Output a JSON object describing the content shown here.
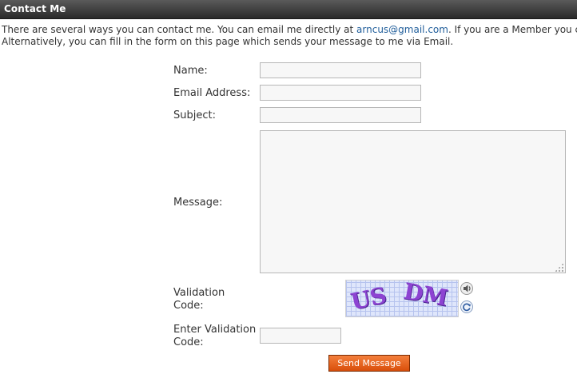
{
  "header": {
    "title": "Contact Me"
  },
  "intro": {
    "line1_before_link": "There are several ways you can contact me. You can email me directly at ",
    "email_link": "arncus@gmail.com",
    "line1_after_link": ". If you are a Member you can se",
    "line2": "Alternatively, you can fill in the form on this page which sends your message to me via Email."
  },
  "form": {
    "name_label": "Name:",
    "name_value": "",
    "email_label": "Email Address:",
    "email_value": "",
    "subject_label": "Subject:",
    "subject_value": "",
    "message_label": "Message:",
    "message_value": "",
    "validation_label_1": "Validation",
    "validation_label_2": "Code:",
    "captcha_text_a": "US",
    "captcha_text_b": "DM",
    "audio_icon": "speaker-icon",
    "refresh_icon": "refresh-icon",
    "enter_validation_label_1": "Enter Validation",
    "enter_validation_label_2": "Code:",
    "enter_validation_value": "",
    "send_label": "Send Message"
  },
  "colors": {
    "header_bg": "#333333",
    "link": "#1f5d9a",
    "send_button": "#e5631f",
    "captcha_text": "#8d43d2"
  }
}
